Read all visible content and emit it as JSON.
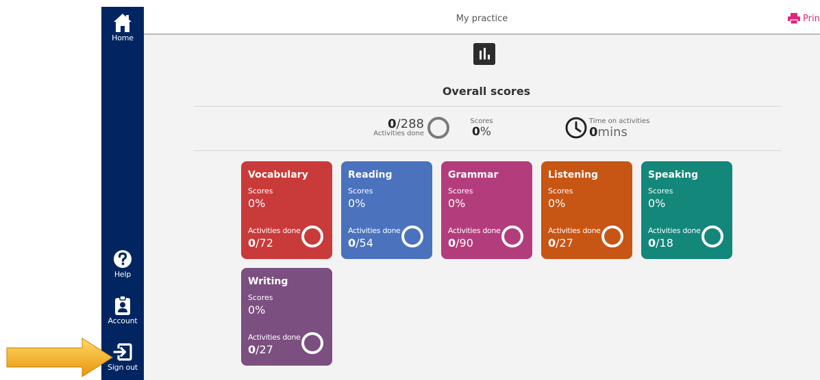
{
  "sidebar": {
    "items": [
      {
        "label": "Home",
        "icon": "home-icon"
      },
      {
        "label": "Help",
        "icon": "help-icon"
      },
      {
        "label": "Account",
        "icon": "account-icon"
      },
      {
        "label": "Sign out",
        "icon": "sign-out-icon"
      }
    ]
  },
  "header": {
    "title": "My practice",
    "print_label": "Prin"
  },
  "overall": {
    "title": "Overall scores",
    "activities_done": "0",
    "activities_total": "/288",
    "activities_label": "Activities done",
    "scores_label": "Scores",
    "scores_value": "0",
    "scores_unit": "%",
    "time_label": "Time on activities",
    "time_value": "0",
    "time_unit": "mins"
  },
  "cards": [
    {
      "title": "Vocabulary",
      "scores_label": "Scores",
      "scores": "0%",
      "activities_label": "Activities done",
      "done": "0",
      "total": "/72",
      "color": "#c93a3a"
    },
    {
      "title": "Reading",
      "scores_label": "Scores",
      "scores": "0%",
      "activities_label": "Activities done",
      "done": "0",
      "total": "/54",
      "color": "#4a72bd"
    },
    {
      "title": "Grammar",
      "scores_label": "Scores",
      "scores": "0%",
      "activities_label": "Activities done",
      "done": "0",
      "total": "/90",
      "color": "#b33d7c"
    },
    {
      "title": "Listening",
      "scores_label": "Scores",
      "scores": "0%",
      "activities_label": "Activities done",
      "done": "0",
      "total": "/27",
      "color": "#c75514"
    },
    {
      "title": "Speaking",
      "scores_label": "Scores",
      "scores": "0%",
      "activities_label": "Activities done",
      "done": "0",
      "total": "/18",
      "color": "#13877a"
    },
    {
      "title": "Writing",
      "scores_label": "Scores",
      "scores": "0%",
      "activities_label": "Activities done",
      "done": "0",
      "total": "/27",
      "color": "#7b4f7f"
    }
  ],
  "colors": {
    "sidebar": "#002561",
    "print": "#e0267b",
    "arrow": "#f0a818"
  }
}
